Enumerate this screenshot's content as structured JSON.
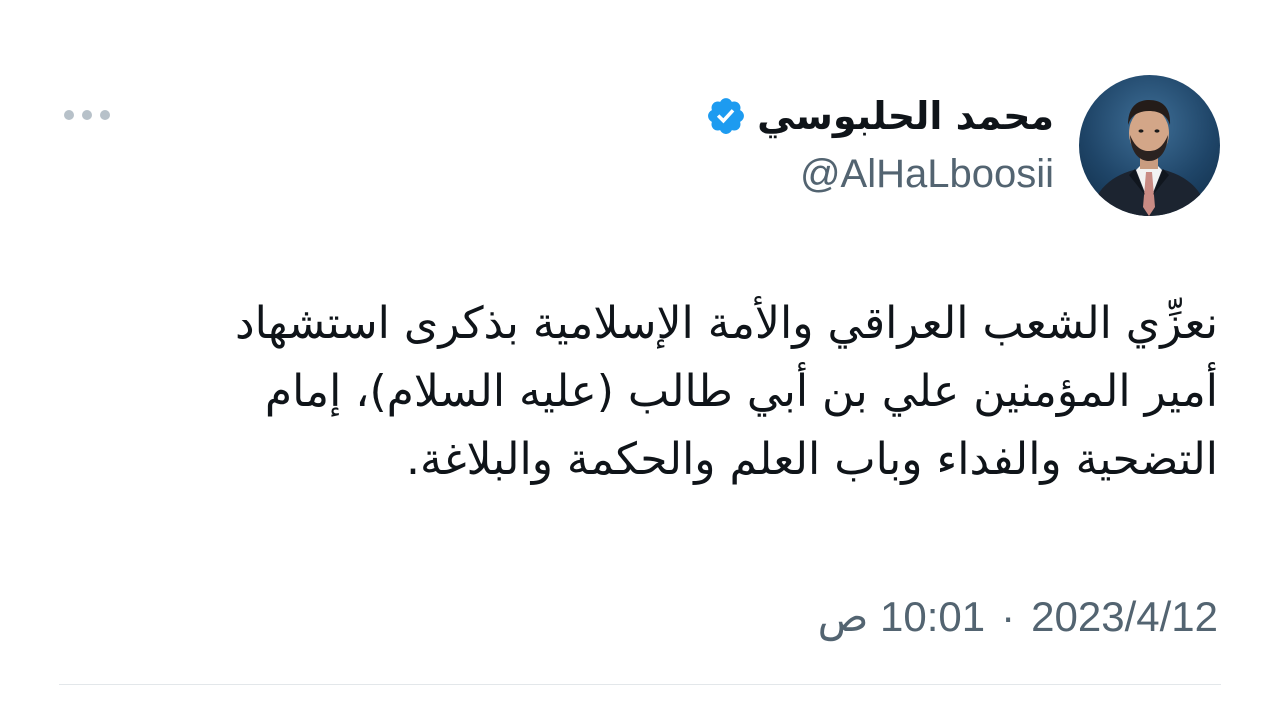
{
  "author": {
    "display_name": "محمد الحلبوسي",
    "handle": "@AlHaLboosii",
    "verified": true,
    "verified_icon": "verified-badge-icon",
    "verified_color": "#1d9bf0"
  },
  "tweet": {
    "lines": [
      "نعزِّي الشعب العراقي والأمة الإسلامية بذكرى استشهاد",
      "أمير المؤمنين علي بن أبي طالب (عليه السلام)، إمام",
      "التضحية والفداء وباب العلم والحكمة والبلاغة."
    ]
  },
  "meta": {
    "time": "10:01 ص",
    "separator": "·",
    "date": "2023/4/12"
  },
  "menu": {
    "icon": "more-options-icon"
  },
  "colors": {
    "text": "#0f1419",
    "secondary": "#536471",
    "divider": "#e3e7ea"
  }
}
